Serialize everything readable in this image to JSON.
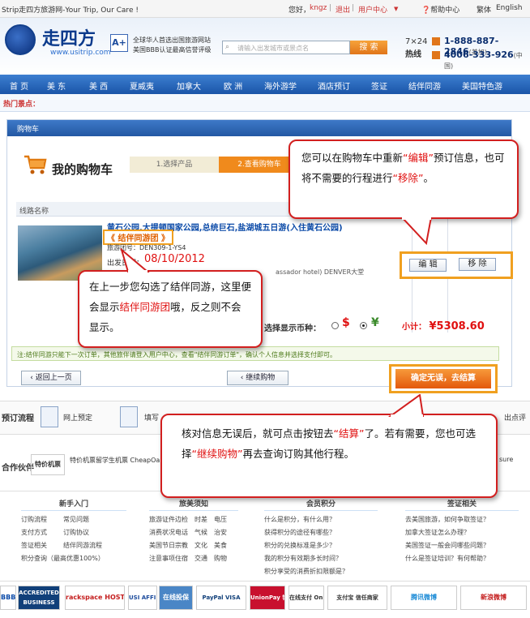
{
  "topbar": {
    "site_title": "Strip走四方旅游网-Your Trip, Our Care !",
    "greeting": "您好，",
    "username": "kngz",
    "divider": "|",
    "logout": "退出",
    "divider2": "|",
    "user_center": "用户中心",
    "user_center_arrow": "▼",
    "help": "帮助中心",
    "lang_trad": "繁体",
    "lang_en": "English"
  },
  "header": {
    "logo_text": "走四方",
    "logo_sub": "www.usitrip.com",
    "aplus": "A+",
    "slogan1": "全球华人首选出国旅游网站",
    "slogan2": "美国BBB认证最高信誉评级",
    "search_placeholder": "请输入出发城市或景点名",
    "search_button": "搜 索",
    "hours": "7×24",
    "hotline": "热线",
    "phone1": "1-888-887-2846",
    "phone1_tag": "(美加)",
    "phone2": "4006-333-926",
    "phone2_tag": "(中国)"
  },
  "nav": [
    "首 页",
    "美 东",
    "美 西",
    "夏威夷",
    "加拿大",
    "欧 洲",
    "海外游学",
    "酒店预订",
    "签证",
    "结伴同游",
    "美国特色游"
  ],
  "hot": {
    "label": "热门景点："
  },
  "cart": {
    "panel_title": "购物车",
    "heading": "我的购物车",
    "step1": "1.选择产品",
    "step2": "2.查看购物车",
    "table_header": "线路名称",
    "product_title": "黄石公园,大提顿国家公园,总统巨石,盐湖城五日游(入住黄石公园)",
    "group_tag": "《 结伴同游团 》",
    "product_code": "旅游团号：DEN309-1-YS4",
    "depart_label": "出发日期：",
    "depart_date": "08/10/2012",
    "hotel": "assador hotel) DENVER大堂",
    "edit_button": "编 辑",
    "remove_button": "移 除",
    "currency_label": "选择显示币种：",
    "usd_symbol": "$",
    "cny_symbol": "¥",
    "subtotal_label": "小计：",
    "subtotal_value": "¥5308.60",
    "notice": "注:结伴同游只能下一次订单，其他旅伴请登入用户中心，查看\"结伴同游订单\"，确认个人信息并选择支付即可。",
    "back_button": "返回上一页",
    "back_icon": "chevron-left",
    "continue_button": "继续购物",
    "continue_icon": "chevron-left",
    "checkout_button": "确定无误，去结算"
  },
  "process": {
    "heading": "预订流程",
    "step1": "网上预定",
    "step2": "填写",
    "step_last": "出点评"
  },
  "partners": {
    "heading": "合作伙伴",
    "box": "特价机票",
    "text": "特价机票留学生机票 CheapOa",
    "tail": "sure"
  },
  "footer": {
    "columns": [
      {
        "title": "新手入门",
        "links": [
          "订购流程",
          "常见问题",
          "支付方式",
          "订购协议",
          "签证相关",
          "结伴同游流程",
          "积分查询（最高优惠100%）"
        ]
      },
      {
        "title": "旅美须知",
        "links": [
          "旅游证件",
          "边检",
          "时差",
          "电压",
          "消费状况",
          "电话",
          "气候",
          "治安",
          "美国节日",
          "宗教",
          "文化",
          "美食",
          "注意事项",
          "住宿",
          "交通",
          "购物"
        ]
      },
      {
        "title": "会员积分",
        "links": [
          "什么是积分，有什么用？",
          "获得积分的途径有哪些？",
          "积分的兑换标准是多少？",
          "我的积分有效期多长时间？",
          "积分享受的消费折扣限额是？"
        ]
      },
      {
        "title": "签证相关",
        "links": [
          "去美国旅游，如何争取签证？",
          "加拿大签证怎么办理？",
          "美国签证一般会问哪些问题？",
          "什么是签证培训？有何帮助？"
        ]
      }
    ]
  },
  "badges": [
    "ACCREDITED BUSINESS",
    "rackspace HOSTING",
    "USI AFFILIATE",
    "在线投保",
    "PayPal VISA",
    "UnionPay 银联",
    "在线支付 Online Pay",
    "支付宝 信任商家",
    "腾讯微博",
    "新浪微博"
  ],
  "badge_top": "BBB",
  "callouts": {
    "edit": {
      "p1": "您可以在购物车中重新",
      "q1": "“编辑”",
      "p2": "预订信息，也可将不需要的行程进行",
      "q2": "“移除”",
      "p3": "。"
    },
    "group": {
      "p1": "在上一步您勾选了结伴同游，这里便会显示",
      "q1": "结伴同游团",
      "p2": "哦，反之则不会显示。"
    },
    "checkout": {
      "p1": "核对信息无误后，就可点击按钮去",
      "q1": "“结算”",
      "p2": "了。若有需要，您也可选择",
      "q2": "“继续购物”",
      "p3": "再去查询订购其他行程。"
    }
  }
}
